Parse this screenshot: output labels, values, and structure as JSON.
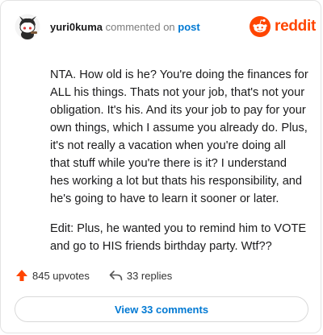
{
  "comment": {
    "username": "yuri0kuma",
    "action_text": "commented on",
    "post_link_label": "post",
    "paragraphs": [
      "NTA. How old is he? You're doing the finances for ALL his things. Thats not your job, that's not your obligation. It's his. And its your job to pay for your own things, which I assume you already do. Plus, it's not really a vacation when you're doing all that stuff while you're there is it? I understand hes working a lot but thats his responsibility, and he's going to have to learn it sooner or later.",
      "Edit: Plus, he wanted you to remind him to VOTE and go to HIS friends birthday party. Wtf??"
    ]
  },
  "brand": {
    "wordmark": "reddit",
    "color": "#ff4500"
  },
  "footer": {
    "upvotes_label": "845 upvotes",
    "replies_label": "33 replies",
    "view_comments_label": "View 33 comments"
  },
  "icons": {
    "upvote": "upvote-arrow-icon",
    "reply": "reply-arrow-icon",
    "brand": "reddit-snoo-icon",
    "avatar": "user-avatar-snoo"
  },
  "colors": {
    "link": "#0079d3",
    "upvote": "#ff4500",
    "text": "#1a1a1b",
    "border": "#e3e3e3"
  }
}
